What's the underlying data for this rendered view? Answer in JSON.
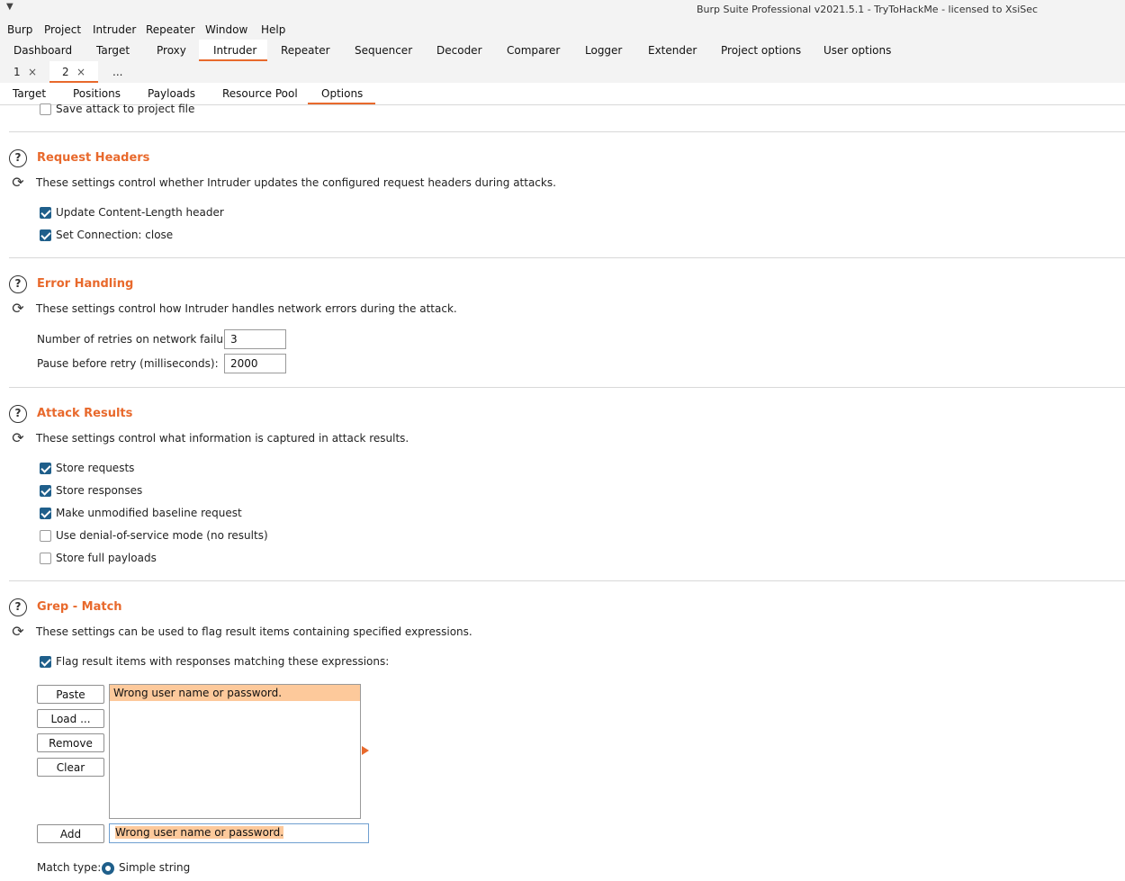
{
  "window": {
    "title": "Burp Suite Professional v2021.5.1 - TryToHackMe - licensed to XsiSec",
    "menu_icon": "chevron-down-icon"
  },
  "menubar": {
    "items": [
      "Burp",
      "Project",
      "Intruder",
      "Repeater",
      "Window",
      "Help"
    ]
  },
  "main_tabs": {
    "items": [
      "Dashboard",
      "Target",
      "Proxy",
      "Intruder",
      "Repeater",
      "Sequencer",
      "Decoder",
      "Comparer",
      "Logger",
      "Extender",
      "Project options",
      "User options"
    ],
    "active": "Intruder"
  },
  "instance_tabs": {
    "items": [
      {
        "label": "1",
        "close": "×"
      },
      {
        "label": "2",
        "close": "×"
      }
    ],
    "more": "...",
    "active": "2"
  },
  "sub_tabs": {
    "items": [
      "Target",
      "Positions",
      "Payloads",
      "Resource Pool",
      "Options"
    ],
    "active": "Options"
  },
  "save_attack": {
    "label": "Save attack to project file",
    "checked": false
  },
  "request_headers": {
    "title": "Request Headers",
    "description": "These settings control whether Intruder updates the configured request headers during attacks.",
    "options": [
      {
        "label": "Update Content-Length header",
        "checked": true
      },
      {
        "label": "Set Connection: close",
        "checked": true
      }
    ]
  },
  "error_handling": {
    "title": "Error Handling",
    "description": "These settings control how Intruder handles network errors during the attack.",
    "retries_label": "Number of retries on network failure:",
    "retries_value": "3",
    "pause_label": "Pause before retry (milliseconds):",
    "pause_value": "2000"
  },
  "attack_results": {
    "title": "Attack Results",
    "description": "These settings control what information is captured in attack results.",
    "options": [
      {
        "label": "Store requests",
        "checked": true
      },
      {
        "label": "Store responses",
        "checked": true
      },
      {
        "label": "Make unmodified baseline request",
        "checked": true
      },
      {
        "label": "Use denial-of-service mode (no results)",
        "checked": false
      },
      {
        "label": "Store full payloads",
        "checked": false
      }
    ]
  },
  "grep_match": {
    "title": "Grep - Match",
    "description": "These settings can be used to flag result items containing specified expressions.",
    "flag_label": "Flag result items with responses matching these expressions:",
    "flag_checked": true,
    "buttons": {
      "paste": "Paste",
      "load": "Load ...",
      "remove": "Remove",
      "clear": "Clear",
      "add": "Add"
    },
    "list_items": [
      "Wrong user name or password."
    ],
    "input_value": "Wrong user name or password.",
    "match_type_label": "Match type:",
    "match_type_option": "Simple string",
    "match_type_selected": true
  },
  "colors": {
    "accent": "#e8692c",
    "checkbox": "#1f5f8b",
    "selection": "#fdc99b"
  },
  "icons": {
    "help": "help-icon",
    "reset": "reset-icon"
  }
}
